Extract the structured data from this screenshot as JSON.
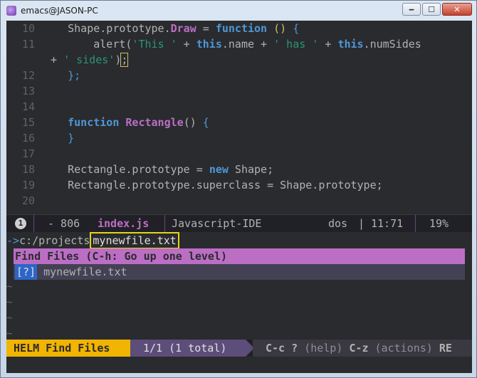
{
  "window": {
    "title": "emacs@JASON-PC",
    "minimize_glyph": "🗕",
    "maximize_glyph": "☐",
    "close_glyph": "✕"
  },
  "code_lines": [
    {
      "num": "10",
      "parts": [
        [
          "plain",
          "    Shape.prototype."
        ],
        [
          "fn",
          "Draw"
        ],
        [
          "plain",
          " = "
        ],
        [
          "kw",
          "function"
        ],
        [
          "plain",
          " "
        ],
        [
          "paren",
          "()"
        ],
        [
          "plain",
          " "
        ],
        [
          "bracket",
          "{"
        ]
      ]
    },
    {
      "num": "11",
      "parts": [
        [
          "plain",
          "        alert("
        ],
        [
          "str",
          "'This '"
        ],
        [
          "plain",
          " + "
        ],
        [
          "kw2",
          "this"
        ],
        [
          "plain",
          ".name + "
        ],
        [
          "str",
          "' has '"
        ],
        [
          "plain",
          " + "
        ],
        [
          "kw2",
          "this"
        ],
        [
          "plain",
          ".numSides"
        ]
      ]
    },
    {
      "num": "",
      "parts": [
        [
          "plain",
          "+ "
        ],
        [
          "str",
          "' sides'"
        ],
        [
          "plain",
          ")"
        ],
        [
          "cursor",
          ";"
        ]
      ]
    },
    {
      "num": "12",
      "parts": [
        [
          "plain",
          "    "
        ],
        [
          "bracket",
          "};"
        ]
      ]
    },
    {
      "num": "13",
      "parts": []
    },
    {
      "num": "14",
      "parts": []
    },
    {
      "num": "15",
      "parts": [
        [
          "plain",
          "    "
        ],
        [
          "kw",
          "function"
        ],
        [
          "plain",
          " "
        ],
        [
          "fn",
          "Rectangle"
        ],
        [
          "plain",
          "() "
        ],
        [
          "bracket",
          "{"
        ]
      ]
    },
    {
      "num": "16",
      "parts": [
        [
          "plain",
          "    "
        ],
        [
          "bracket",
          "}"
        ]
      ]
    },
    {
      "num": "17",
      "parts": []
    },
    {
      "num": "18",
      "parts": [
        [
          "plain",
          "    Rectangle.prototype = "
        ],
        [
          "kw",
          "new"
        ],
        [
          "plain",
          " Shape;"
        ]
      ]
    },
    {
      "num": "19",
      "parts": [
        [
          "plain",
          "    Rectangle.prototype.superclass = Shape.prototype;"
        ]
      ]
    },
    {
      "num": "20",
      "parts": []
    }
  ],
  "modeline": {
    "window_number": "1",
    "dash_size": "- 806",
    "buffer_name": "index.js",
    "major_mode": "Javascript-IDE",
    "eol": "dos",
    "separator": "|",
    "position": "11:71",
    "percent": "19%"
  },
  "minibuffer": {
    "arrow": "->",
    "directory": "c:/projects",
    "input": "mynewfile.txt"
  },
  "helm": {
    "header": "Find Files (C-h: Go up one level)",
    "candidates": [
      {
        "mark": "[?]",
        "name": "mynewfile.txt"
      }
    ],
    "tildes": [
      "~",
      "~",
      "~",
      "~"
    ]
  },
  "helm_modeline": {
    "tag": "HELM Find Files",
    "count": "1/1 (1 total)",
    "key1": "C-c ?",
    "hint1": "(help)",
    "key2": "C-z",
    "hint2": "(actions)",
    "key3": "RE"
  },
  "colors": {
    "background": "#292b2e",
    "keyword": "#4f97d7",
    "function": "#bc6ec5",
    "string": "#2d9574",
    "highlight_box": "#e6d31b",
    "helm_tag": "#f1b400"
  }
}
